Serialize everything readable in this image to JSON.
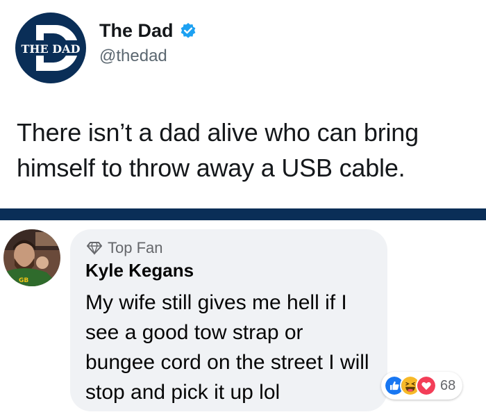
{
  "tweet": {
    "avatar_text": "THE DAD",
    "display_name": "The Dad",
    "handle": "@thedad",
    "text": "There isn’t a dad alive who can bring himself to throw away a USB cable."
  },
  "comment": {
    "badge": "Top Fan",
    "author": "Kyle Kegans",
    "text": "My wife still gives me hell if I see a good tow strap or bungee cord on the street I will stop and pick it up lol",
    "reaction_count": "68",
    "reactions": [
      "like-icon",
      "haha-icon",
      "love-icon"
    ]
  },
  "colors": {
    "brand_navy": "#0a2e57",
    "verified_blue": "#1da1f2",
    "bubble_bg": "#f0f2f5",
    "like_blue": "#1877f2",
    "love_red": "#f33e58",
    "haha_yellow": "#f7b928"
  }
}
